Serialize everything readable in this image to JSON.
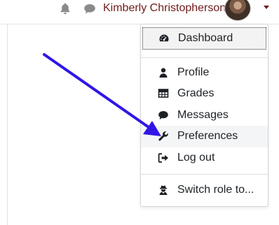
{
  "header": {
    "user_name": "Kimberly Christopherson",
    "icons": {
      "notifications": "bell-icon",
      "messages": "chat-bubble-icon",
      "user_menu_toggle": "caret-down-icon"
    },
    "accent_color": "#6f1a1a"
  },
  "user_menu": {
    "items": [
      {
        "label": "Dashboard",
        "icon": "dashboard-gauge-icon"
      },
      {
        "label": "Profile",
        "icon": "user-icon"
      },
      {
        "label": "Grades",
        "icon": "table-icon"
      },
      {
        "label": "Messages",
        "icon": "comment-icon"
      },
      {
        "label": "Preferences",
        "icon": "wrench-icon"
      },
      {
        "label": "Log out",
        "icon": "sign-out-icon"
      },
      {
        "label": "Switch role to...",
        "icon": "user-secret-icon"
      }
    ]
  },
  "annotation": {
    "arrow_color": "#2f16e6",
    "arrow_target": "Preferences"
  }
}
